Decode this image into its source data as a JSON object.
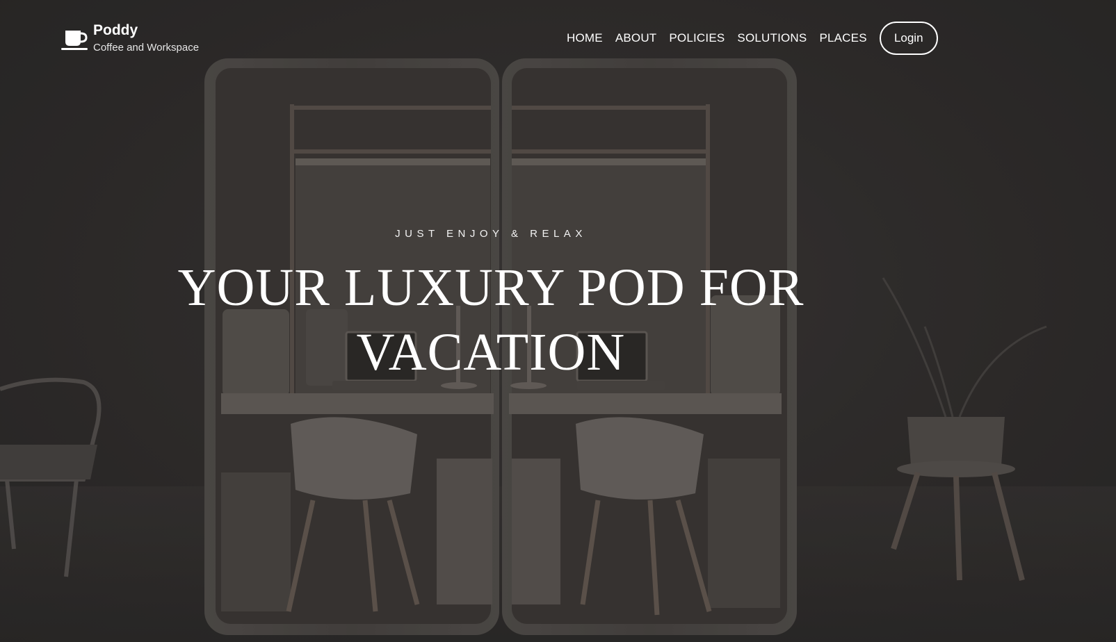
{
  "brand": {
    "name": "Poddy",
    "tagline": "Coffee and Workspace",
    "icon": "coffee-cup-icon"
  },
  "nav": {
    "items": [
      {
        "label": "HOME"
      },
      {
        "label": "ABOUT"
      },
      {
        "label": "POLICIES"
      },
      {
        "label": "SOLUTIONS"
      },
      {
        "label": "PLACES"
      }
    ],
    "login_label": "Login"
  },
  "hero": {
    "kicker": "JUST ENJOY & RELAX",
    "headline": "YOUR LUXURY POD FOR VACATION"
  },
  "colors": {
    "background": "#2f2e2d",
    "text": "#ffffff",
    "pod_shell": "#5a5754"
  }
}
